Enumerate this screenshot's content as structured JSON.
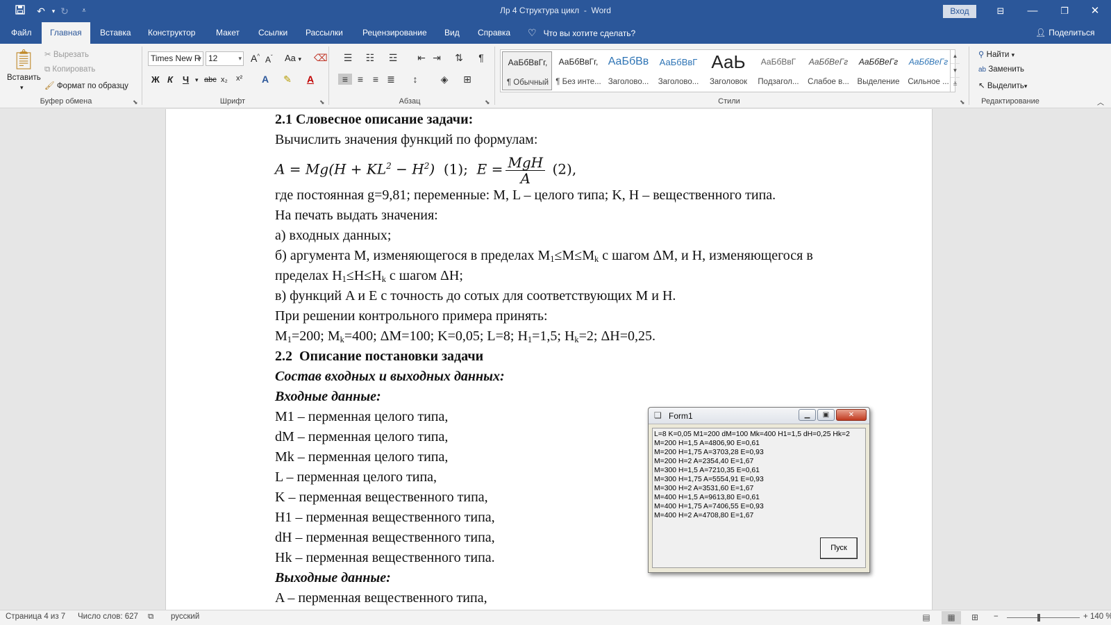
{
  "titlebar": {
    "doc_title": "Лр 4 Структура цикл",
    "app_sep": "-",
    "app_name": "Word",
    "signin_label": "Вход",
    "qa_save_icon": "save-icon",
    "qa_undo_icon": "undo-icon",
    "qa_redo_icon": "redo-icon",
    "qa_customize_icon": "customize-icon"
  },
  "tabs": [
    {
      "label": "Файл"
    },
    {
      "label": "Главная"
    },
    {
      "label": "Вставка"
    },
    {
      "label": "Конструктор"
    },
    {
      "label": "Макет"
    },
    {
      "label": "Ссылки"
    },
    {
      "label": "Рассылки"
    },
    {
      "label": "Рецензирование"
    },
    {
      "label": "Вид"
    },
    {
      "label": "Справка"
    }
  ],
  "tell_me": "Что вы хотите сделать?",
  "share": "Поделиться",
  "ribbon": {
    "clipboard": {
      "label": "Буфер обмена",
      "paste": "Вставить",
      "cut": "Вырезать",
      "copy": "Копировать",
      "format_painter": "Формат по образцу"
    },
    "font": {
      "label": "Шрифт",
      "font_name": "Times New R",
      "font_size": "12",
      "bold": "Ж",
      "italic": "К",
      "underline": "Ч",
      "strike": "abc",
      "subscript": "x₂",
      "superscript": "x²",
      "grow": "A",
      "shrink": "A",
      "change_case": "Aa"
    },
    "paragraph": {
      "label": "Абзац"
    },
    "styles": {
      "label": "Стили",
      "items": [
        {
          "preview": "АаБбВвГг,",
          "name": "¶ Обычный"
        },
        {
          "preview": "АаБбВвГг,",
          "name": "¶ Без инте..."
        },
        {
          "preview": "АаБбВв",
          "name": "Заголово..."
        },
        {
          "preview": "АаБбВвГ",
          "name": "Заголово..."
        },
        {
          "preview": "АаЬ",
          "name": "Заголовок"
        },
        {
          "preview": "АаБбВвГ",
          "name": "Подзагол..."
        },
        {
          "preview": "АаБбВеГг",
          "name": "Слабое в..."
        },
        {
          "preview": "АаБбВеГг",
          "name": "Выделение"
        },
        {
          "preview": "АаБбВеГг",
          "name": "Сильное ..."
        }
      ]
    },
    "editing": {
      "label": "Редактирование",
      "find": "Найти",
      "replace": "Заменить",
      "select": "Выделить"
    }
  },
  "document": {
    "h21": "2.1 Словесное описание задачи:",
    "l_compute": "Вычислить значения функций по формулам:",
    "f_A": "A = Mg(H + KL",
    "f_A_sup1": "2",
    "f_A_mid": " − H",
    "f_A_sup2": "2",
    "f_A_end": ")",
    "f_num1": "(1);",
    "f_E": "E =",
    "f_E_num": "MgH",
    "f_E_den": "A",
    "f_num2": "(2),",
    "l_where": "где постоянная g=9,81; переменные: M, L – целого типа; K, H – вещественного типа.",
    "l_print": "На печать выдать значения:",
    "l_a": "а) входных данных;",
    "l_b1_pre": "б) аргумента M, изменяющегося в пределах M",
    "l_b1_s1": "1",
    "l_b1_mid": "≤M≤M",
    "l_b1_s2": "k",
    "l_b1_post": " с шагом ΔM, и H, изменяющегося в",
    "l_b2_pre": "пределах H",
    "l_b2_s1": "1",
    "l_b2_mid": "≤H≤H",
    "l_b2_s2": "k",
    "l_b2_post": " с шагом ΔH;",
    "l_c": "в) функций A и E с точность до сотых для соответствующих M и H.",
    "l_solve": "При решении контрольного примера принять:",
    "l_vals_1": "M",
    "l_vals_s1": "1",
    "l_vals_2": "=200; M",
    "l_vals_s2": "k",
    "l_vals_3": "=400; ΔM=100; K=0,05; L=8; H",
    "l_vals_s3": "1",
    "l_vals_4": "=1,5; H",
    "l_vals_s4": "k",
    "l_vals_5": "=2; ΔH=0,25.",
    "h22": "2.2  Описание постановки задачи",
    "h_io": "Состав входных и выходных данных:",
    "h_in": "Входные данные:",
    "vars_in": [
      "M1 – перменная целого типа,",
      "dM – перменная целого типа,",
      "Mk – перменная целого типа,",
      "L – перменная целого типа,",
      "K – перменная вещественного типа,",
      "H1 – перменная вещественного типа,",
      "dH – перменная вещественного типа,",
      "Hk – перменная вещественного типа."
    ],
    "h_out": "Выходные данные:",
    "l_out_a": "A – перменная вещественного типа,"
  },
  "form1": {
    "title": "Form1",
    "output_lines": [
      "L=8 K=0,05 M1=200 dM=100 Mk=400 H1=1,5 dH=0,25 Hk=2",
      "M=200 H=1,5 A=4806,90 E=0,61",
      "M=200 H=1,75 A=3703,28 E=0,93",
      "M=200 H=2 A=2354,40 E=1,67",
      "M=300 H=1,5 A=7210,35 E=0,61",
      "M=300 H=1,75 A=5554,91 E=0,93",
      "M=300 H=2 A=3531,60 E=1,67",
      "M=400 H=1,5 A=9613,80 E=0,61",
      "M=400 H=1,75 A=7406,55 E=0,93",
      "M=400 H=2 A=4708,80 E=1,67"
    ],
    "run_button": "Пуск"
  },
  "status": {
    "page": "Страница 4 из 7",
    "words": "Число слов: 627",
    "language": "русский",
    "zoom": "140 %",
    "zoom_minus": "−",
    "zoom_plus": "+"
  }
}
